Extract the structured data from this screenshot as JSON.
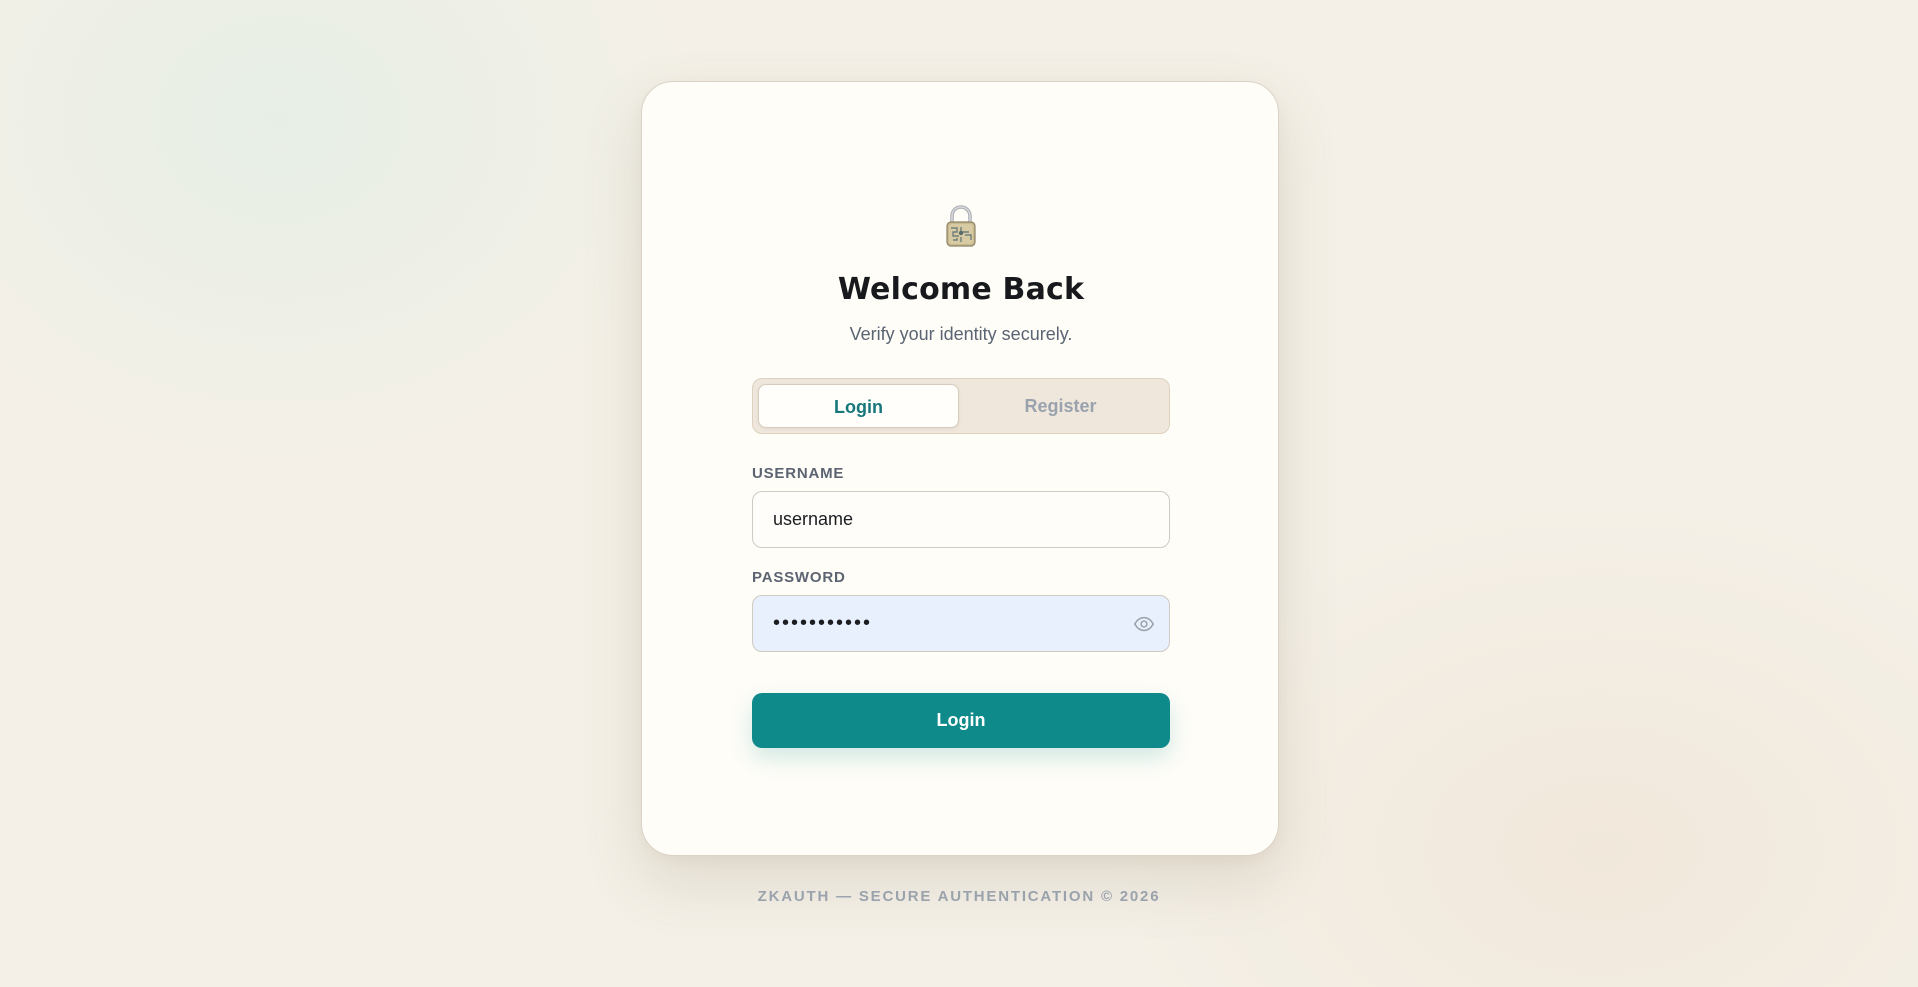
{
  "logo": {
    "icon": "padlock-icon"
  },
  "heading": {
    "title": "Welcome Back",
    "subtitle": "Verify your identity securely."
  },
  "tabs": [
    {
      "label": "Login",
      "active": true
    },
    {
      "label": "Register",
      "active": false
    }
  ],
  "form": {
    "username_label": "USERNAME",
    "username_value": "username",
    "password_label": "PASSWORD",
    "password_value": "•••••••••••",
    "password_toggle_icon": "eye-icon",
    "submit_label": "Login"
  },
  "footer": {
    "text": "ZKAUTH — SECURE AUTHENTICATION © 2026"
  },
  "colors": {
    "accent": "#0f8a8a",
    "active_tab_text": "#17777a",
    "autofill_bg": "#e8f0fe"
  }
}
